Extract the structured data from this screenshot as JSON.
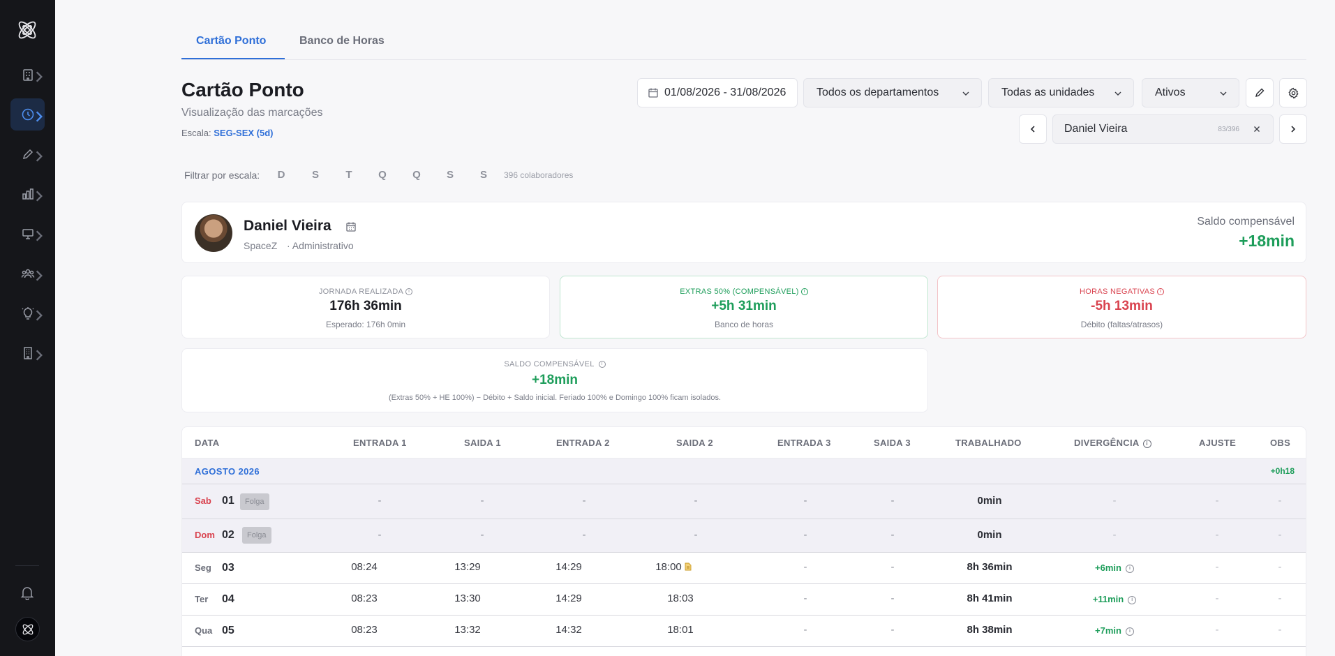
{
  "tabs": [
    {
      "label": "Cartão Ponto"
    },
    {
      "label": "Banco de Horas"
    }
  ],
  "header": {
    "title": "Cartão Ponto",
    "subtitle": "Visualização das marcações",
    "escala_label": "Escala:",
    "escala_value": "SEG-SEX (5d)"
  },
  "controls": {
    "date_range": "01/08/2026 - 31/08/2026",
    "department": "Todos os departamentos",
    "unit": "Todas as unidades",
    "status": "Ativos",
    "employee": "Daniel Vieira",
    "employee_count": "83/396"
  },
  "filter": {
    "label": "Filtrar por escala:",
    "days": [
      "D",
      "S",
      "T",
      "Q",
      "Q",
      "S",
      "S"
    ],
    "collaborators": "396 colaboradores"
  },
  "employee": {
    "name": "Daniel Vieira",
    "company": "SpaceZ",
    "department": "· Administrativo",
    "saldo_label": "Saldo compensável",
    "saldo_value": "+18min"
  },
  "stats": {
    "jornada": {
      "label": "JORNADA REALIZADA",
      "value": "176h 36min",
      "sub": "Esperado: 176h 0min"
    },
    "extras": {
      "label": "EXTRAS 50% (COMPENSÁVEL)",
      "value": "+5h 31min",
      "sub": "Banco de horas"
    },
    "negativas": {
      "label": "HORAS NEGATIVAS",
      "value": "-5h 13min",
      "sub": "Débito (faltas/atrasos)"
    },
    "saldo": {
      "label": "SALDO COMPENSÁVEL",
      "value": "+18min",
      "sub": "(Extras 50% + HE 100%) − Débito + Saldo inicial. Feriado 100% e Domingo 100% ficam isolados."
    }
  },
  "table": {
    "headers": {
      "data": "DATA",
      "e1": "ENTRADA 1",
      "s1": "SAIDA 1",
      "e2": "ENTRADA 2",
      "s2": "SAIDA 2",
      "e3": "ENTRADA 3",
      "s3": "SAIDA 3",
      "trab": "TRABALHADO",
      "div": "DIVERGÊNCIA",
      "aj": "AJUSTE",
      "obs": "OBS"
    },
    "month": {
      "label": "AGOSTO 2026",
      "total": "+0h18"
    },
    "rows": [
      {
        "dow": "Sab",
        "day": "01",
        "folga": "Folga",
        "e1": "-",
        "s1": "-",
        "e2": "-",
        "s2": "-",
        "e3": "-",
        "s3": "-",
        "worked": "0min",
        "div": "-",
        "aj": "-",
        "obs": "-"
      },
      {
        "dow": "Dom",
        "day": "02",
        "folga": "Folga",
        "e1": "-",
        "s1": "-",
        "e2": "-",
        "s2": "-",
        "e3": "-",
        "s3": "-",
        "worked": "0min",
        "div": "-",
        "aj": "-",
        "obs": "-"
      },
      {
        "dow": "Seg",
        "day": "03",
        "e1": "08:24",
        "s1": "13:29",
        "e2": "14:29",
        "s2": "18:00",
        "e3": "-",
        "s3": "-",
        "worked": "8h 36min",
        "div": "+6min",
        "aj": "-",
        "obs": "-"
      },
      {
        "dow": "Ter",
        "day": "04",
        "e1": "08:23",
        "s1": "13:30",
        "e2": "14:29",
        "s2": "18:03",
        "e3": "-",
        "s3": "-",
        "worked": "8h 41min",
        "div": "+11min",
        "aj": "-",
        "obs": "-"
      },
      {
        "dow": "Qua",
        "day": "05",
        "e1": "08:23",
        "s1": "13:32",
        "e2": "14:32",
        "s2": "18:01",
        "e3": "-",
        "s3": "-",
        "worked": "8h 38min",
        "div": "+7min",
        "aj": "-",
        "obs": "-"
      }
    ]
  },
  "colors": {
    "accent": "#2f6fd8",
    "positive": "#1d9d5a",
    "negative": "#d9434f",
    "sidebar": "#15161a"
  }
}
